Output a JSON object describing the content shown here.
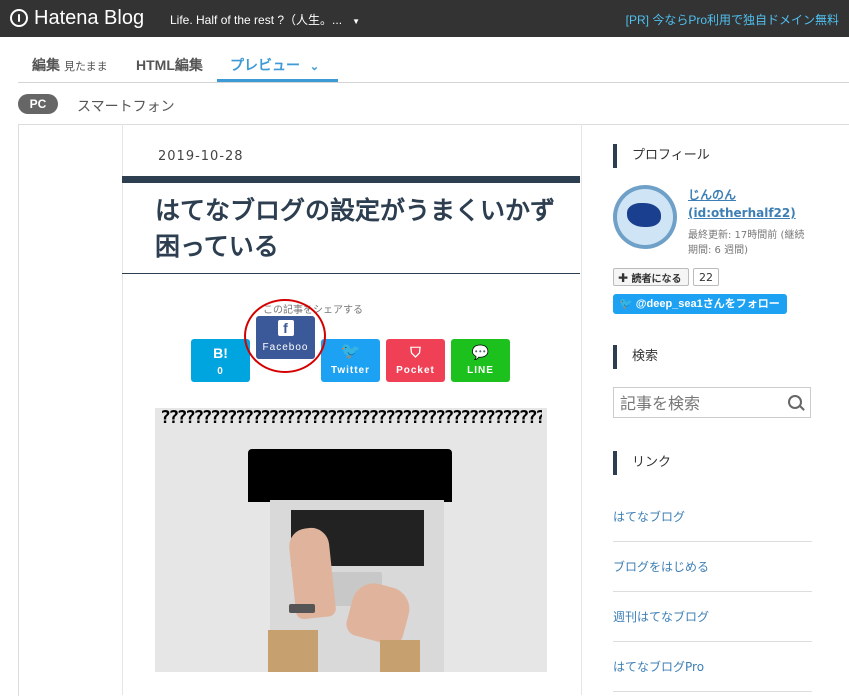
{
  "topbar": {
    "brand": "Hatena Blog",
    "blog_title": "Life. Half of the rest ?（人生。...",
    "promo": "[PR] 今ならPro利用で独自ドメイン無料"
  },
  "tabs": {
    "edit": "編集",
    "edit_sub": "見たまま",
    "html_edit": "HTML編集",
    "preview": "プレビュー"
  },
  "device": {
    "pc": "PC",
    "smartphone": "スマートフォン"
  },
  "article": {
    "date": "2019-10-28",
    "title": "はてなブログの設定がうまくいかず困っている",
    "share_lead": "この記事をシェアする",
    "share": {
      "hatena_icon": "B!",
      "hatena_count": "0",
      "facebook_label": "Faceboo",
      "twitter_label": "Twitter",
      "pocket_label": "Pocket",
      "line_label": "LINE"
    },
    "image_pattern": "??????????????????????????????????????????????????????????????????????????????????????????????????????????????????????????????????????????????????????????????????????????????????????????????????????????????????????????????????????????????????????????????????????????????????????????????????????????????????????????????????????????????????????????????????????????????????????????????????????????????????????????????????????????????????????"
  },
  "sidebar": {
    "profile_heading": "プロフィール",
    "profile_name": "じんのん",
    "profile_id": "(id:otherhalf22)",
    "last_update": "最終更新: 17時間前 (継続期間: 6 週間)",
    "reader_button": "読者になる",
    "reader_count": "22",
    "twitter_follow": "@deep_sea1さんをフォロー",
    "search_heading": "検索",
    "search_placeholder": "記事を検索",
    "links_heading": "リンク",
    "links": [
      "はてなブログ",
      "ブログをはじめる",
      "週刊はてなブログ",
      "はてなブログPro"
    ]
  },
  "colors": {
    "topbar": "#333333",
    "accent": "#3d9ad5",
    "title": "#2c3e50",
    "hatena": "#00a4de",
    "facebook": "#3b5998",
    "twitter": "#1da1f2",
    "pocket": "#ef4056",
    "line": "#1dc11d",
    "highlight_circle": "#d40000"
  },
  "icons": {
    "brand": "hatena-logo-icon",
    "caret": "caret-down-icon",
    "search": "search-icon",
    "plus": "plus-icon",
    "twitter": "twitter-bird-icon"
  }
}
